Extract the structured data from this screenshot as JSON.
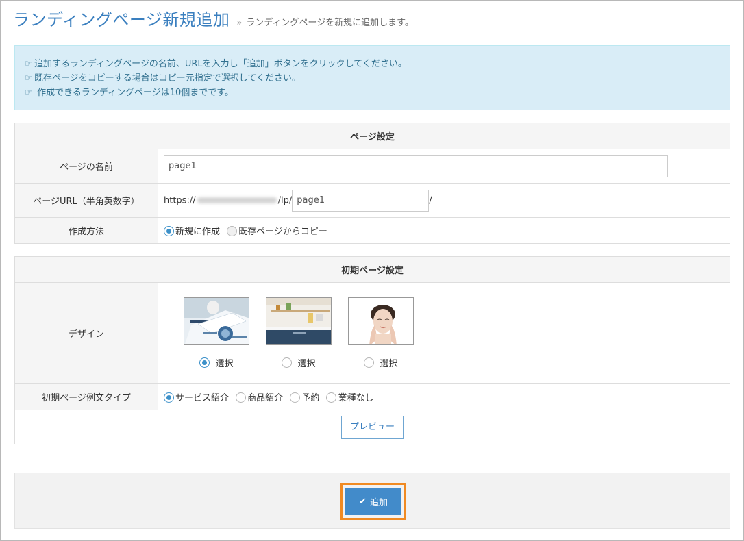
{
  "header": {
    "title": "ランディングページ新規追加",
    "raquo": "»",
    "subtitle": "ランディングページを新規に追加します。"
  },
  "info": {
    "lines": [
      "追加するランディングページの名前、URLを入力し「追加」ボタンをクリックしてください。",
      "既存ページをコピーする場合はコピー元指定で選択してください。",
      " 作成できるランディングページは10個までです。"
    ]
  },
  "page_settings": {
    "section_title": "ページ設定",
    "name_label": "ページの名前",
    "name_value": "page1",
    "url_label": "ページURL（半角英数字）",
    "url_prefix": "https://",
    "url_middle": "/lp/",
    "url_value": "page1",
    "url_suffix": "/",
    "method_label": "作成方法",
    "method_options": [
      "新規に作成",
      "既存ページからコピー"
    ]
  },
  "initial_settings": {
    "section_title": "初期ページ設定",
    "design_label": "デザイン",
    "design_select_label": "選択",
    "type_label": "初期ページ例文タイプ",
    "type_options": [
      "サービス紹介",
      "商品紹介",
      "予約",
      "業種なし"
    ],
    "preview_label": "プレビュー"
  },
  "footer": {
    "add_label": "追加"
  },
  "colors": {
    "accent": "#428bca",
    "highlight": "#f08a22",
    "info_bg": "#d9edf7"
  }
}
